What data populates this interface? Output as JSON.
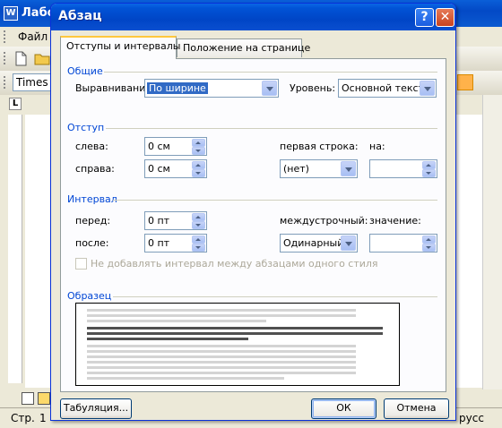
{
  "background_window": {
    "title": "Лабо",
    "menu_file": "Файл",
    "font_name": "Times Ne",
    "status_page": "Стр.",
    "status_page_num": "1",
    "status_lang": "русс"
  },
  "dialog": {
    "title": "Абзац",
    "help_glyph": "?",
    "close_glyph": "✕",
    "tabs": [
      {
        "label": "Отступы и интервалы",
        "active": true
      },
      {
        "label": "Положение на странице",
        "active": false
      }
    ],
    "general": {
      "group_label": "Общие",
      "alignment_label": "Выравнивание:",
      "alignment_value": "По ширине",
      "level_label": "Уровень:",
      "level_value": "Основной текст"
    },
    "indent": {
      "group_label": "Отступ",
      "left_label": "слева:",
      "left_value": "0 см",
      "right_label": "справа:",
      "right_value": "0 см",
      "first_line_label": "первая строка:",
      "first_line_value": "(нет)",
      "by_label": "на:",
      "by_value": ""
    },
    "spacing": {
      "group_label": "Интервал",
      "before_label": "перед:",
      "before_value": "0 пт",
      "after_label": "после:",
      "after_value": "0 пт",
      "line_label": "междустрочный:",
      "line_value": "Одинарный",
      "at_label": "значение:",
      "at_value": "",
      "dont_add_label": "Не добавлять интервал между абзацами одного стиля",
      "dont_add_checked": false
    },
    "preview": {
      "group_label": "Образец"
    },
    "buttons": {
      "tabs_label": "Табуляция...",
      "ok_label": "ОК",
      "cancel_label": "Отмена"
    }
  },
  "colors": {
    "title_blue": "#0054e3",
    "group_label_blue": "#0046d5",
    "selection_blue": "#316ac5",
    "dialog_face": "#ece9d8",
    "close_red": "#d6502e"
  }
}
